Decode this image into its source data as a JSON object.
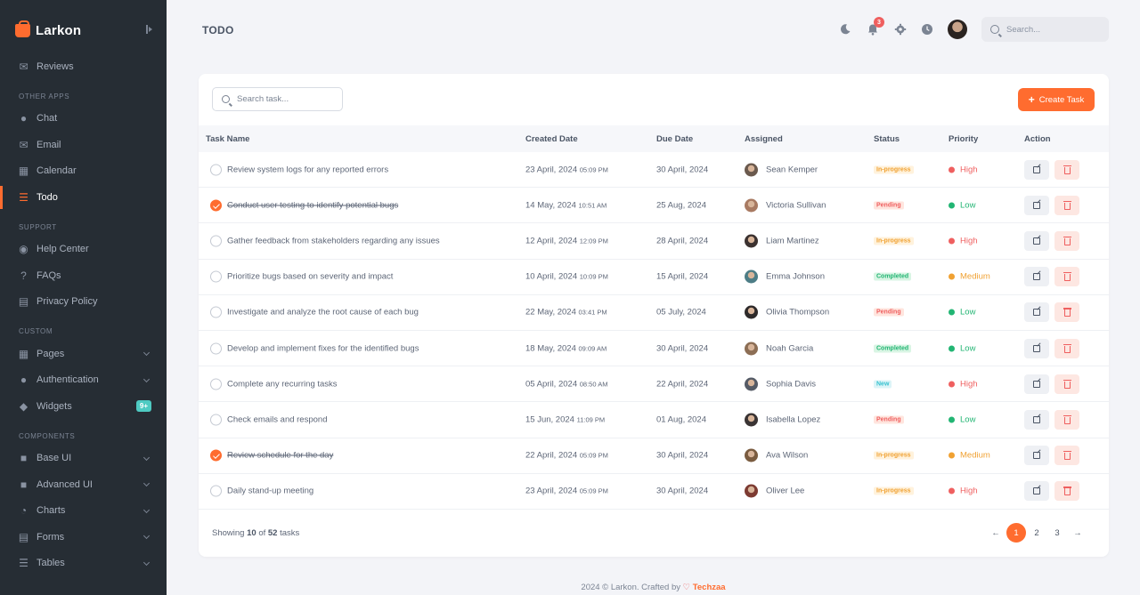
{
  "app": {
    "name": "Larkon"
  },
  "colors": {
    "accent": "#ff6c2f",
    "sidebar_bg": "#262d34",
    "high": "#ef5f5f",
    "low": "#22b573",
    "medium": "#f0a132"
  },
  "sidebar": {
    "items_top": [
      {
        "label": "Reviews",
        "icon": "review-icon"
      }
    ],
    "section_other": "OTHER APPS",
    "other_apps": [
      {
        "label": "Chat",
        "icon": "chat-icon"
      },
      {
        "label": "Email",
        "icon": "email-icon"
      },
      {
        "label": "Calendar",
        "icon": "calendar-icon"
      },
      {
        "label": "Todo",
        "icon": "todo-icon",
        "active": true
      }
    ],
    "section_support": "SUPPORT",
    "support": [
      {
        "label": "Help Center",
        "icon": "help-icon"
      },
      {
        "label": "FAQs",
        "icon": "faq-icon"
      },
      {
        "label": "Privacy Policy",
        "icon": "privacy-icon"
      }
    ],
    "section_custom": "CUSTOM",
    "custom": [
      {
        "label": "Pages",
        "icon": "pages-icon"
      },
      {
        "label": "Authentication",
        "icon": "lock-icon"
      },
      {
        "label": "Widgets",
        "icon": "widgets-icon",
        "badge": "9+"
      }
    ],
    "section_components": "COMPONENTS",
    "components": [
      {
        "label": "Base UI",
        "icon": "base-ui-icon"
      },
      {
        "label": "Advanced UI",
        "icon": "advanced-ui-icon"
      },
      {
        "label": "Charts",
        "icon": "chart-icon"
      },
      {
        "label": "Forms",
        "icon": "form-icon"
      },
      {
        "label": "Tables",
        "icon": "table-icon"
      }
    ]
  },
  "header": {
    "title": "TODO",
    "notifications": "3",
    "search_placeholder": "Search..."
  },
  "toolbar": {
    "search_placeholder": "Search task...",
    "create_label": "Create Task"
  },
  "table": {
    "columns": [
      "Task Name",
      "Created Date",
      "Due Date",
      "Assigned",
      "Status",
      "Priority",
      "Action"
    ],
    "rows": [
      {
        "done": false,
        "task": "Review system logs for any reported errors",
        "created": "23 April, 2024",
        "created_time": "05:09 PM",
        "due": "30 April, 2024",
        "assigned": "Sean Kemper",
        "status": "In-progress",
        "priority": "High"
      },
      {
        "done": true,
        "task": "Conduct user testing to identify potential bugs",
        "created": "14 May, 2024",
        "created_time": "10:51 AM",
        "due": "25 Aug, 2024",
        "assigned": "Victoria Sullivan",
        "status": "Pending",
        "priority": "Low"
      },
      {
        "done": false,
        "task": "Gather feedback from stakeholders regarding any issues",
        "created": "12 April, 2024",
        "created_time": "12:09 PM",
        "due": "28 April, 2024",
        "assigned": "Liam Martinez",
        "status": "In-progress",
        "priority": "High"
      },
      {
        "done": false,
        "task": "Prioritize bugs based on severity and impact",
        "created": "10 April, 2024",
        "created_time": "10:09 PM",
        "due": "15 April, 2024",
        "assigned": "Emma Johnson",
        "status": "Completed",
        "priority": "Medium"
      },
      {
        "done": false,
        "task": "Investigate and analyze the root cause of each bug",
        "created": "22 May, 2024",
        "created_time": "03:41 PM",
        "due": "05 July, 2024",
        "assigned": "Olivia Thompson",
        "status": "Pending",
        "priority": "Low"
      },
      {
        "done": false,
        "task": "Develop and implement fixes for the identified bugs",
        "created": "18 May, 2024",
        "created_time": "09:09 AM",
        "due": "30 April, 2024",
        "assigned": "Noah Garcia",
        "status": "Completed",
        "priority": "Low"
      },
      {
        "done": false,
        "task": "Complete any recurring tasks",
        "created": "05 April, 2024",
        "created_time": "08:50 AM",
        "due": "22 April, 2024",
        "assigned": "Sophia Davis",
        "status": "New",
        "priority": "High"
      },
      {
        "done": false,
        "task": "Check emails and respond",
        "created": "15 Jun, 2024",
        "created_time": "11:09 PM",
        "due": "01 Aug, 2024",
        "assigned": "Isabella Lopez",
        "status": "Pending",
        "priority": "Low"
      },
      {
        "done": true,
        "task": "Review schedule for the day",
        "created": "22 April, 2024",
        "created_time": "05:09 PM",
        "due": "30 April, 2024",
        "assigned": "Ava Wilson",
        "status": "In-progress",
        "priority": "Medium"
      },
      {
        "done": false,
        "task": "Daily stand-up meeting",
        "created": "23 April, 2024",
        "created_time": "05:09 PM",
        "due": "30 April, 2024",
        "assigned": "Oliver Lee",
        "status": "In-progress",
        "priority": "High"
      }
    ]
  },
  "pagination": {
    "showing_prefix": "Showing",
    "shown": "10",
    "of": "of",
    "total": "52",
    "suffix": "tasks",
    "prev": "←",
    "next": "→",
    "pages": [
      "1",
      "2",
      "3"
    ],
    "current": "1"
  },
  "footer": {
    "text": "2024 © Larkon. Crafted by",
    "heart": "♡",
    "brand": "Techzaa"
  }
}
